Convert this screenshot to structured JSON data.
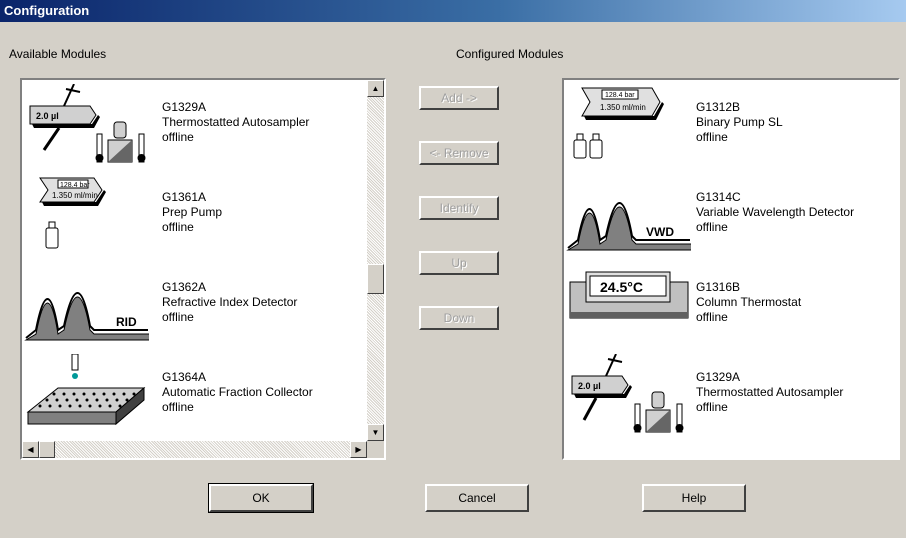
{
  "window": {
    "title": "Configuration"
  },
  "labels": {
    "available": "Available Modules",
    "configured": "Configured Modules"
  },
  "available_modules": [
    {
      "id": "G1329A",
      "name": "Thermostatted Autosampler",
      "status": "offline",
      "icon": "autosampler-icon",
      "icon_text": "2.0 µl"
    },
    {
      "id": "G1361A",
      "name": "Prep Pump",
      "status": "offline",
      "icon": "pump-icon",
      "icon_text_1": "128.4 bar",
      "icon_text_2": "1.350 ml/min"
    },
    {
      "id": "G1362A",
      "name": "Refractive Index Detector",
      "status": "offline",
      "icon": "detector-icon",
      "icon_text": "RID"
    },
    {
      "id": "G1364A",
      "name": "Automatic Fraction Collector",
      "status": "offline",
      "icon": "fraction-collector-icon"
    }
  ],
  "configured_modules": [
    {
      "id": "G1312B",
      "name": "Binary Pump SL",
      "status": "offline",
      "icon": "binary-pump-icon",
      "icon_text_1": "128.4 bar",
      "icon_text_2": "1.350 ml/min"
    },
    {
      "id": "G1314C",
      "name": "Variable Wavelength Detector",
      "status": "offline",
      "icon": "detector-icon",
      "icon_text": "VWD"
    },
    {
      "id": "G1316B",
      "name": "Column Thermostat",
      "status": "offline",
      "icon": "column-thermostat-icon",
      "icon_text": "24.5°C"
    },
    {
      "id": "G1329A",
      "name": "Thermostatted Autosampler",
      "status": "offline",
      "icon": "autosampler-icon",
      "icon_text": "2.0 µl"
    }
  ],
  "actions": {
    "add": "Add ->",
    "remove": "<- Remove",
    "identify": "Identify",
    "up": "Up",
    "down": "Down"
  },
  "footer": {
    "ok": "OK",
    "cancel": "Cancel",
    "help": "Help"
  }
}
